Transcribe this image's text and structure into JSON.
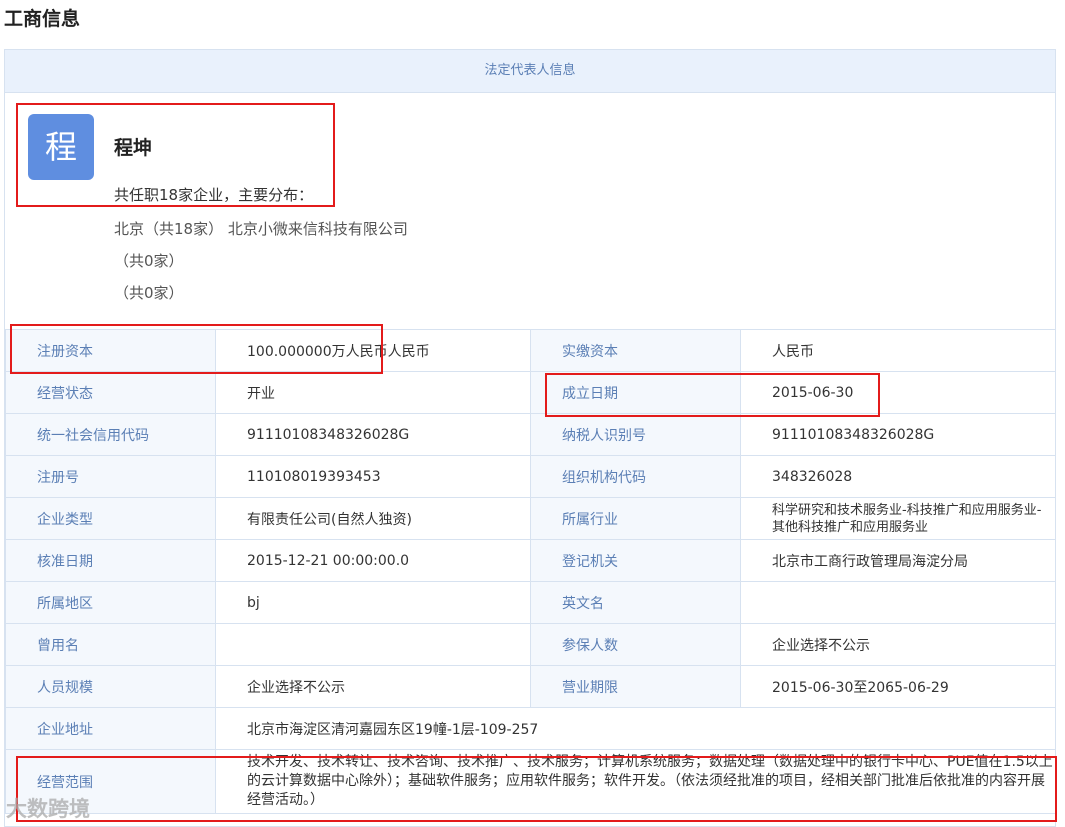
{
  "page_title": "工商信息",
  "card_header": "法定代表人信息",
  "legal_rep": {
    "avatar_char": "程",
    "name": "程坤",
    "summary": "共任职18家企业，主要分布：",
    "lines": [
      "北京（共18家） 北京小微来信科技有限公司",
      "（共0家）",
      "（共0家）"
    ]
  },
  "rows": [
    [
      {
        "label": "注册资本",
        "value": "100.000000万人民币人民币"
      },
      {
        "label": "实缴资本",
        "value": "人民币"
      }
    ],
    [
      {
        "label": "经营状态",
        "value": "开业"
      },
      {
        "label": "成立日期",
        "value": "2015-06-30"
      }
    ],
    [
      {
        "label": "统一社会信用代码",
        "value": "91110108348326028G"
      },
      {
        "label": "纳税人识别号",
        "value": "91110108348326028G"
      }
    ],
    [
      {
        "label": "注册号",
        "value": "110108019393453"
      },
      {
        "label": "组织机构代码",
        "value": "348326028"
      }
    ],
    [
      {
        "label": "企业类型",
        "value": "有限责任公司(自然人独资)"
      },
      {
        "label": "所属行业",
        "value": "科学研究和技术服务业-科技推广和应用服务业- 其他科技推广和应用服务业"
      }
    ],
    [
      {
        "label": "核准日期",
        "value": "2015-12-21 00:00:00.0"
      },
      {
        "label": "登记机关",
        "value": "北京市工商行政管理局海淀分局"
      }
    ],
    [
      {
        "label": "所属地区",
        "value": "bj"
      },
      {
        "label": "英文名",
        "value": ""
      }
    ],
    [
      {
        "label": "曾用名",
        "value": ""
      },
      {
        "label": "参保人数",
        "value": "企业选择不公示"
      }
    ],
    [
      {
        "label": "人员规模",
        "value": "企业选择不公示"
      },
      {
        "label": "营业期限",
        "value": "2015-06-30至2065-06-29"
      }
    ]
  ],
  "address": {
    "label": "企业地址",
    "value": "北京市海淀区清河嘉园东区19幢-1层-109-257"
  },
  "scope": {
    "label": "经营范围",
    "value": "技术开发、技术转让、技术咨询、技术推广、技术服务；计算机系统服务；数据处理（数据处理中的银行卡中心、PUE值在1.5以上的云计算数据中心除外）；基础软件服务；应用软件服务；软件开发。（依法须经批准的项目，经相关部门批准后依批准的内容开展经营活动。）"
  },
  "watermark": "大数跨境",
  "highlight_color": "#e31b1b"
}
